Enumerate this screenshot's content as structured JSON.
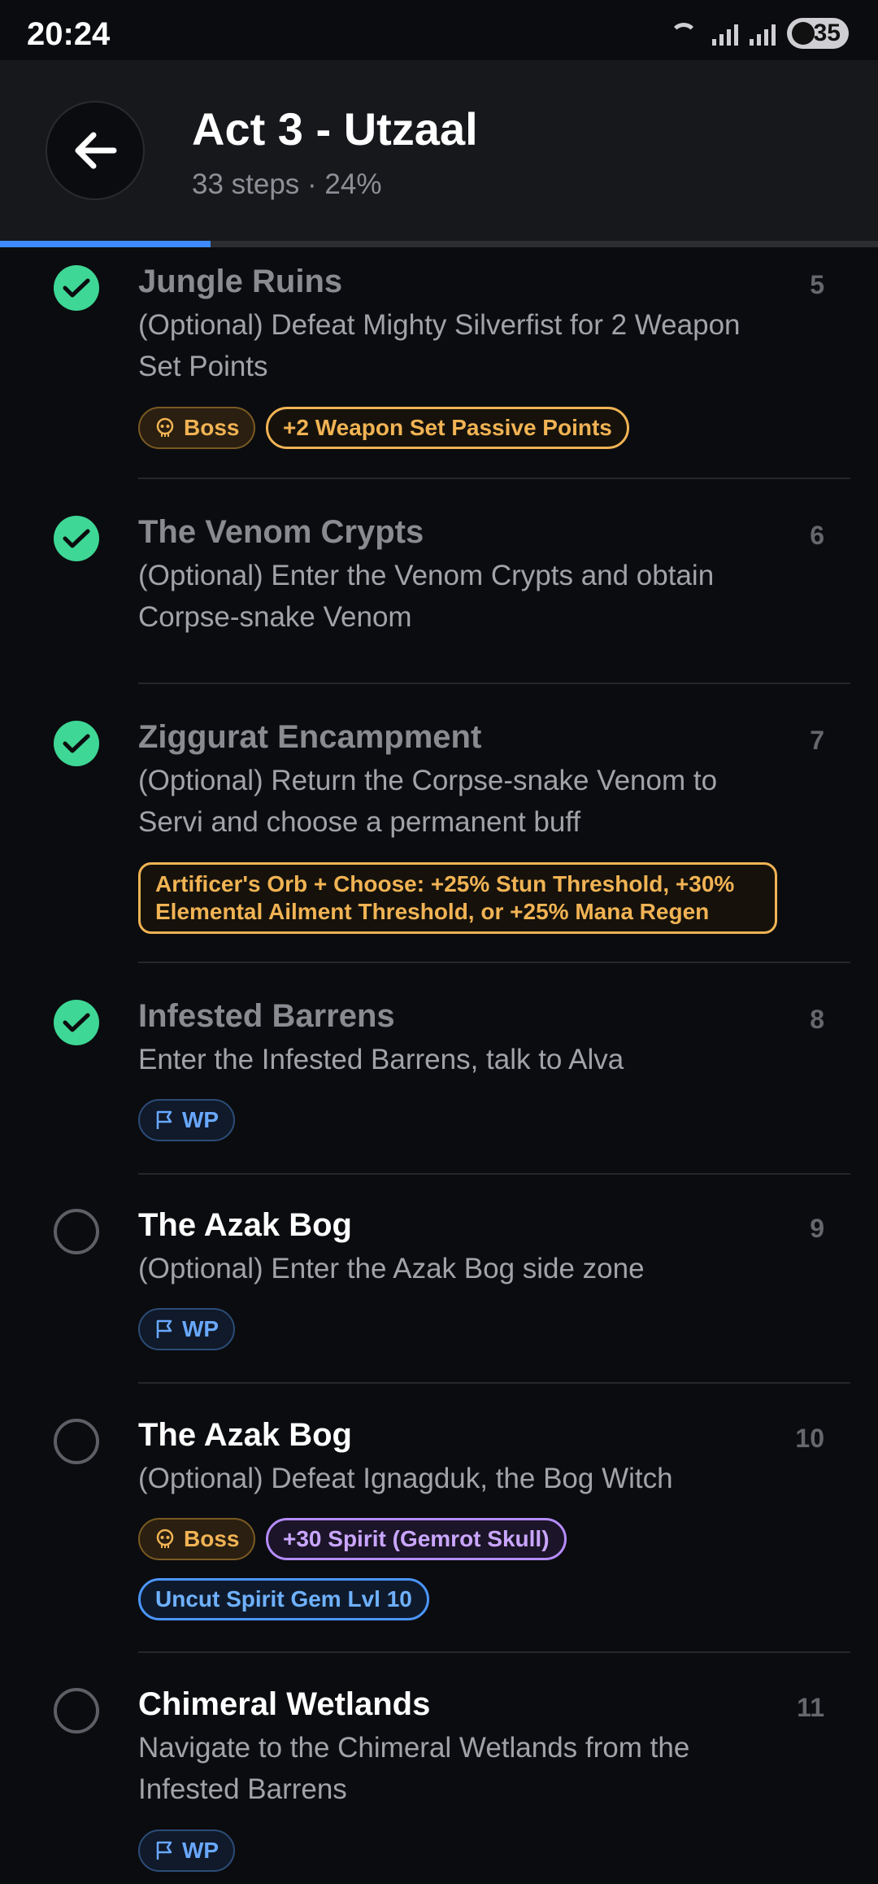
{
  "status": {
    "time": "20:24",
    "battery": "35",
    "wifi_badge": "5"
  },
  "header": {
    "title": "Act 3 - Utzaal",
    "subtitle": "33 steps · 24%",
    "progress_fraction": 0.24
  },
  "steps": [
    {
      "name": "Jungle Ruins",
      "num": "5",
      "done": true,
      "desc": "(Optional) Defeat Mighty Silverfist for 2 Weapon Set Points",
      "tags": [
        "Boss",
        "+2 Weapon Set Passive Points"
      ]
    },
    {
      "name": "The Venom Crypts",
      "num": "6",
      "done": true,
      "desc": "(Optional) Enter the Venom Crypts and obtain Corpse-snake Venom",
      "tags": []
    },
    {
      "name": "Ziggurat Encampment",
      "num": "7",
      "done": true,
      "desc": "(Optional) Return the Corpse-snake Venom to Servi and choose a permanent buff",
      "tags": [
        "Artificer's Orb + Choose: +25% Stun Threshold, +30% Elemental Ailment Threshold, or +25% Mana Regen"
      ]
    },
    {
      "name": "Infested Barrens",
      "num": "8",
      "done": true,
      "desc": "Enter the Infested Barrens, talk to Alva",
      "tags": [
        "WP"
      ]
    },
    {
      "name": "The Azak Bog",
      "num": "9",
      "done": false,
      "desc": "(Optional) Enter the Azak Bog side zone",
      "tags": [
        "WP"
      ]
    },
    {
      "name": "The Azak Bog",
      "num": "10",
      "done": false,
      "desc": "(Optional) Defeat Ignagduk, the Bog Witch",
      "tags": [
        "Boss",
        "+30 Spirit (Gemrot Skull)",
        "Uncut Spirit Gem Lvl 10"
      ]
    },
    {
      "name": "Chimeral Wetlands",
      "num": "11",
      "done": false,
      "desc": "Navigate to the Chimeral Wetlands from the Infested Barrens",
      "tags": [
        "WP"
      ]
    }
  ],
  "colors": {
    "done": "#3ed795",
    "progress": "#3d8bfd",
    "reward": "#f1b354",
    "wp": "#69a8ff",
    "spirit": "#c9a6ff"
  }
}
